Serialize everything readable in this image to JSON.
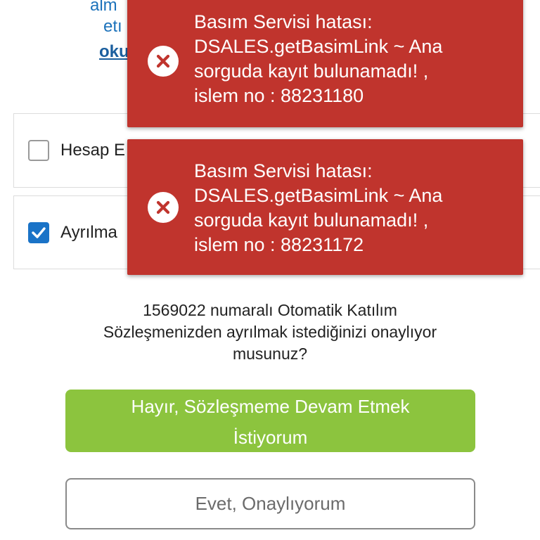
{
  "background_text": {
    "line1": "alm",
    "line2": "etı",
    "link": "oku"
  },
  "options": [
    {
      "label": "Hesap E",
      "checked": false
    },
    {
      "label": "Ayrılma",
      "checked": true
    }
  ],
  "toasts": [
    {
      "lines": [
        "Basım Servisi hatası:",
        "DSALES.getBasimLink ~ Ana",
        "sorguda kayıt bulunamadı! ,",
        "islem no : 88231180"
      ],
      "icon": "error-x-icon"
    },
    {
      "lines": [
        "Basım Servisi hatası:",
        "DSALES.getBasimLink ~ Ana",
        "sorguda kayıt bulunamadı! ,",
        "islem no : 88231172"
      ],
      "icon": "error-x-icon"
    }
  ],
  "question": {
    "lines": [
      "1569022 numaralı Otomatik Katılım",
      "Sözleşmenizden ayrılmak istediğinizi onaylıyor",
      "musunuz?"
    ]
  },
  "buttons": {
    "no_line1": "Hayır, Sözleşmeme Devam Etmek",
    "no_line2": "İstiyorum",
    "yes": "Evet, Onaylıyorum"
  },
  "colors": {
    "toast_bg": "#c0342d",
    "primary_green": "#8cc43e",
    "link_blue": "#1c72bb",
    "checkbox_blue": "#1a73c7"
  }
}
